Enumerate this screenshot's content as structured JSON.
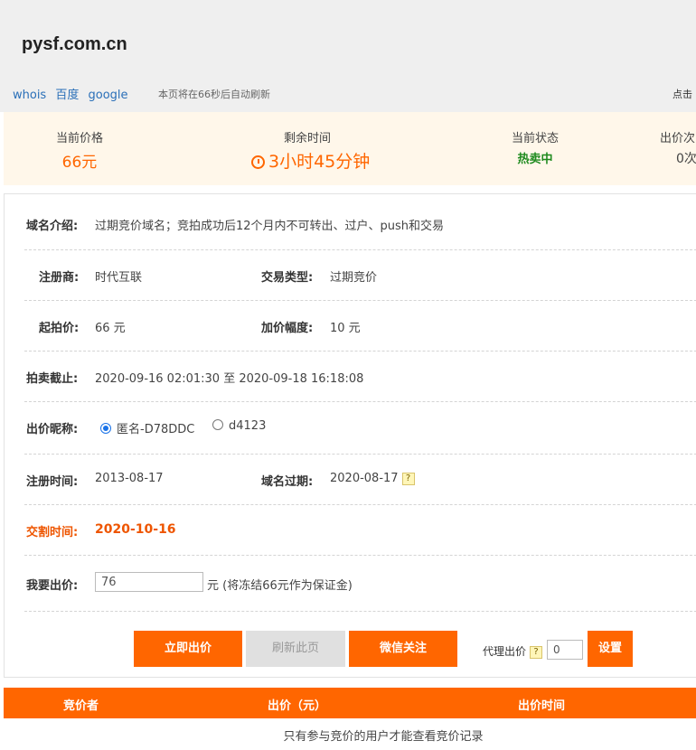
{
  "header": {
    "domain": "pysf.com.cn",
    "links": [
      "whois",
      "百度",
      "google"
    ],
    "refresh_note": "本页将在66秒后自动刷新",
    "click_note": "点击"
  },
  "summary": {
    "price_label": "当前价格",
    "price_value": "66元",
    "time_label": "剩余时间",
    "time_value": "3小时45分钟",
    "status_label": "当前状态",
    "status_value": "热卖中",
    "bids_label": "出价次",
    "bids_value": "0次"
  },
  "detail": {
    "intro_label": "域名介绍:",
    "intro_value": "过期竞价域名；竞拍成功后12个月内不可转出、过户、push和交易",
    "registrar_label": "注册商:",
    "registrar_value": "时代互联",
    "trade_type_label": "交易类型:",
    "trade_type_value": "过期竞价",
    "start_price_label": "起拍价:",
    "start_price_value": "66 元",
    "increment_label": "加价幅度:",
    "increment_value": "10 元",
    "deadline_label": "拍卖截止:",
    "deadline_value": "2020-09-16 02:01:30 至 2020-09-18 16:18:08",
    "nickname_label": "出价昵称:",
    "nickname_option1": "匿名-D78DDC",
    "nickname_option2": "d4123",
    "reg_time_label": "注册时间:",
    "reg_time_value": "2013-08-17",
    "expire_label": "域名过期:",
    "expire_value": "2020-08-17",
    "delivery_label": "交割时间:",
    "delivery_value": "2020-10-16",
    "bid_label": "我要出价:",
    "bid_value": "76",
    "bid_note": "元 (将冻结66元作为保证金)",
    "help_mark": "?"
  },
  "actions": {
    "bid_now": "立即出价",
    "refresh": "刷新此页",
    "wechat": "微信关注",
    "proxy_label": "代理出价",
    "proxy_value": "0",
    "set": "设置"
  },
  "table": {
    "col_bidder": "竞价者",
    "col_price": "出价（元）",
    "col_time": "出价时间",
    "empty_note": "只有参与竞价的用户才能查看竞价记录"
  },
  "colors": {
    "accent": "#ff6600",
    "status_green": "#1e8a1e",
    "link_blue": "#2a6fb8"
  }
}
